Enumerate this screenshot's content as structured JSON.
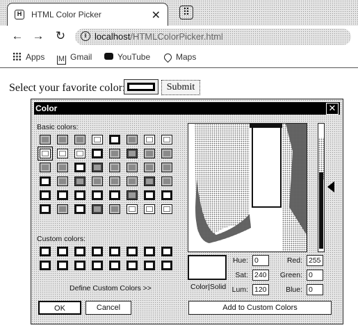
{
  "browser": {
    "tab_title": "HTML Color Picker",
    "tab_close": "✕",
    "new_tab_icon": "⠿",
    "back": "←",
    "forward": "→",
    "reload": "↻",
    "url_host": "localhost",
    "url_path": "/HTMLColorPicker.html",
    "bookmarks": [
      "Apps",
      "Gmail",
      "YouTube",
      "Maps"
    ]
  },
  "page": {
    "prompt": "Select your favorite color:",
    "submit_label": "Submit"
  },
  "dialog": {
    "title": "Color",
    "close": "✕",
    "basic_colors_label": "Basic colors:",
    "basic_colors": [
      [
        "mid",
        "mid",
        "mid",
        "light",
        "black",
        "mid",
        "light",
        "light"
      ],
      [
        "sel",
        "light",
        "light",
        "black",
        "mid",
        "dark",
        "mid",
        "mid"
      ],
      [
        "mid",
        "mid",
        "black",
        "dark",
        "mid",
        "mid",
        "mid",
        "mid"
      ],
      [
        "black",
        "mid",
        "dark",
        "mid",
        "mid",
        "mid",
        "dark",
        "mid"
      ],
      [
        "black",
        "black",
        "black",
        "black",
        "black",
        "dark",
        "black",
        "black"
      ],
      [
        "black",
        "mid",
        "black",
        "dark",
        "mid",
        "light",
        "light",
        "light"
      ]
    ],
    "custom_colors_label": "Custom colors:",
    "custom_rows": 2,
    "define_label": "Define Custom Colors >>",
    "ok_label": "OK",
    "cancel_label": "Cancel",
    "add_label": "Add to Custom Colors",
    "color_solid_label": "Color|Solid",
    "hue_label": "Hue:",
    "hue": "0",
    "sat_label": "Sat:",
    "sat": "240",
    "lum_label": "Lum:",
    "lum": "120",
    "red_label": "Red:",
    "red": "255",
    "green_label": "Green:",
    "green": "0",
    "blue_label": "Blue:",
    "blue": "0"
  }
}
